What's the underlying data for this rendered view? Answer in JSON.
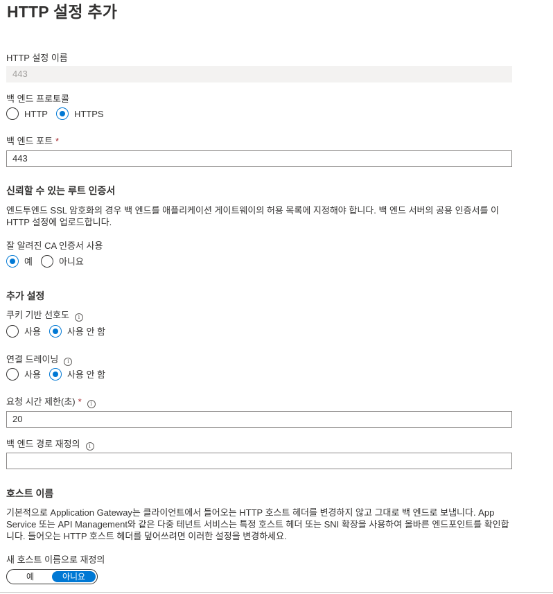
{
  "page_title": "HTTP 설정 추가",
  "http_setting_name": {
    "label": "HTTP 설정 이름",
    "value": "443"
  },
  "backend_protocol": {
    "label": "백 엔드 프로토콜",
    "options": [
      "HTTP",
      "HTTPS"
    ],
    "selected": "HTTPS"
  },
  "backend_port": {
    "label": "백 엔드 포트",
    "required_mark": "*",
    "value": "443"
  },
  "trusted_root": {
    "heading": "신뢰할 수 있는 루트 인증서",
    "description": "엔드투엔드 SSL 암호화의 경우 백 엔드를 애플리케이션 게이트웨이의 허용 목록에 지정해야 합니다. 백 엔드 서버의 공용 인증서를 이 HTTP 설정에 업로드합니다.",
    "well_known_ca_label": "잘 알려진 CA 인증서 사용",
    "options": [
      "예",
      "아니요"
    ],
    "selected": "예"
  },
  "additional": {
    "heading": "추가 설정",
    "cookie_affinity": {
      "label": "쿠키 기반 선호도",
      "info_icon": "info-icon",
      "options": [
        "사용",
        "사용 안 함"
      ],
      "selected": "사용 안 함"
    },
    "connection_draining": {
      "label": "연결 드레이닝",
      "info_icon": "info-icon",
      "options": [
        "사용",
        "사용 안 함"
      ],
      "selected": "사용 안 함"
    },
    "request_timeout": {
      "label": "요청 시간 제한(초)",
      "required_mark": "*",
      "value": "20"
    },
    "backend_path_override": {
      "label": "백 엔드 경로 재정의",
      "value": ""
    }
  },
  "host_name": {
    "heading": "호스트 이름",
    "description": "기본적으로 Application Gateway는 클라이언트에서 들어오는 HTTP 호스트 헤더를 변경하지 않고 그대로 백 엔드로 보냅니다. App Service 또는 API Management와 같은 다중 테넌트 서비스는 특정 호스트 헤더 또는 SNI 확장을 사용하여 올바른 엔드포인트를 확인합니다. 들어오는 HTTP 호스트 헤더를 덮어쓰려면 이러한 설정을 변경하세요.",
    "override_label": "새 호스트 이름으로 재정의",
    "toggle_options": [
      "예",
      "아니요"
    ],
    "selected": "아니요"
  },
  "colors": {
    "accent": "#0078d4",
    "required": "#a4262c",
    "disabled_bg": "#f3f2f1"
  }
}
